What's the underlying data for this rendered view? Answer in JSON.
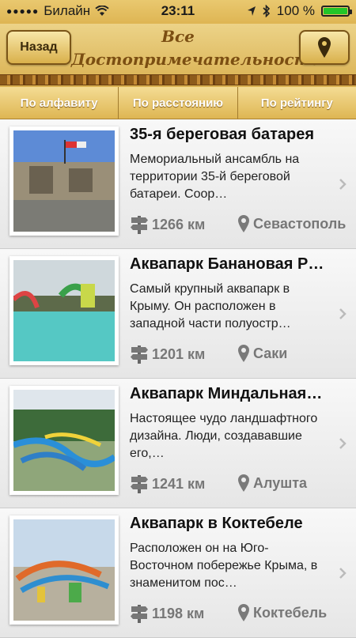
{
  "status_bar": {
    "carrier": "Билайн",
    "time": "23:11",
    "battery": "100 %",
    "battery_level": 1.0
  },
  "nav": {
    "back_label": "Назад",
    "title_line1": "Все",
    "title_line2": "Достопримечательности",
    "map_icon": "location-pin-icon"
  },
  "tabs": [
    "По алфавиту",
    "По расстоянию",
    "По рейтингу"
  ],
  "items": [
    {
      "name": "35-я береговая батарея",
      "description": "Мемориальный ансамбль на территории 35-й береговой батареи. Соор…",
      "distance": "1266 км",
      "city": "Севастополь"
    },
    {
      "name": "Аквапарк Банановая Р…",
      "description": "Самый крупный аквапарк в Крыму. Он расположен в западной части полуостр…",
      "distance": "1201 км",
      "city": "Саки"
    },
    {
      "name": "Аквапарк Миндальная…",
      "description": "Настоящее чудо ландшафтного дизайна. Люди, создававшие его,…",
      "distance": "1241 км",
      "city": "Алушта"
    },
    {
      "name": "Аквапарк в Коктебеле",
      "description": "Расположен он на Юго-Восточном побережье Крыма, в знаменитом пос…",
      "distance": "1198 км",
      "city": "Коктебель"
    }
  ]
}
